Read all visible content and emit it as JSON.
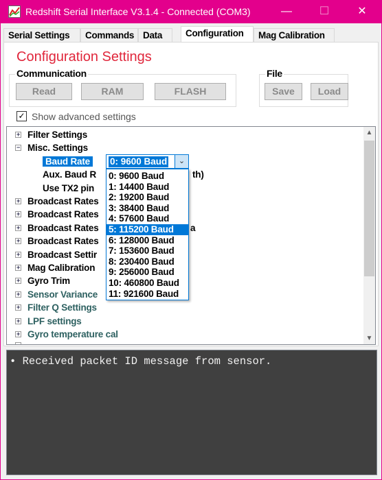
{
  "window": {
    "title": "Redshift Serial Interface V3.1.4 - Connected (COM3)",
    "minimize": "—",
    "maximize": "☐",
    "close": "✕",
    "accent": "#e3008c"
  },
  "tabs": [
    {
      "label": "Serial Settings"
    },
    {
      "label": "Commands"
    },
    {
      "label": "Data"
    },
    {
      "label": "Configuration",
      "active": true
    },
    {
      "label": "Mag Calibration"
    }
  ],
  "config": {
    "heading": "Configuration Settings",
    "communication": {
      "label": "Communication",
      "read": "Read",
      "ram": "RAM",
      "flash": "FLASH"
    },
    "file": {
      "label": "File",
      "save": "Save",
      "load": "Load"
    },
    "show_advanced": {
      "label": "Show advanced settings",
      "checked": true
    }
  },
  "tree": {
    "items": [
      {
        "label": "Filter Settings",
        "expanded": false
      },
      {
        "label": "Misc. Settings",
        "expanded": true
      },
      {
        "label": "Baud Rate",
        "child": true,
        "selected": true
      },
      {
        "label": "Aux. Baud R",
        "tail": "th)",
        "child": true
      },
      {
        "label": "Use TX2 pin",
        "child": true
      },
      {
        "label": "Broadcast Rates"
      },
      {
        "label": "Broadcast Rates"
      },
      {
        "label": "Broadcast Rates",
        "tail": "a"
      },
      {
        "label": "Broadcast Rates"
      },
      {
        "label": "Broadcast Settir"
      },
      {
        "label": "Mag Calibration"
      },
      {
        "label": "Gyro Trim"
      },
      {
        "label": "Sensor Variance",
        "teal": true
      },
      {
        "label": "Filter Q Settings",
        "teal": true
      },
      {
        "label": "LPF settings",
        "teal": true
      },
      {
        "label": "Gyro temperature cal",
        "teal": true
      }
    ],
    "baud_combo": {
      "value": "0: 9600 Baud",
      "highlighted": "5: 115200 Baud",
      "options": [
        "0: 9600 Baud",
        "1: 14400 Baud",
        "2: 19200 Baud",
        "3: 38400 Baud",
        "4: 57600 Baud",
        "5: 115200 Baud",
        "6: 128000 Baud",
        "7: 153600 Baud",
        "8: 230400 Baud",
        "9: 256000 Baud",
        "10: 460800 Baud",
        "11: 921600 Baud"
      ]
    }
  },
  "log": {
    "lines": [
      "• Received packet ID message from sensor."
    ]
  }
}
